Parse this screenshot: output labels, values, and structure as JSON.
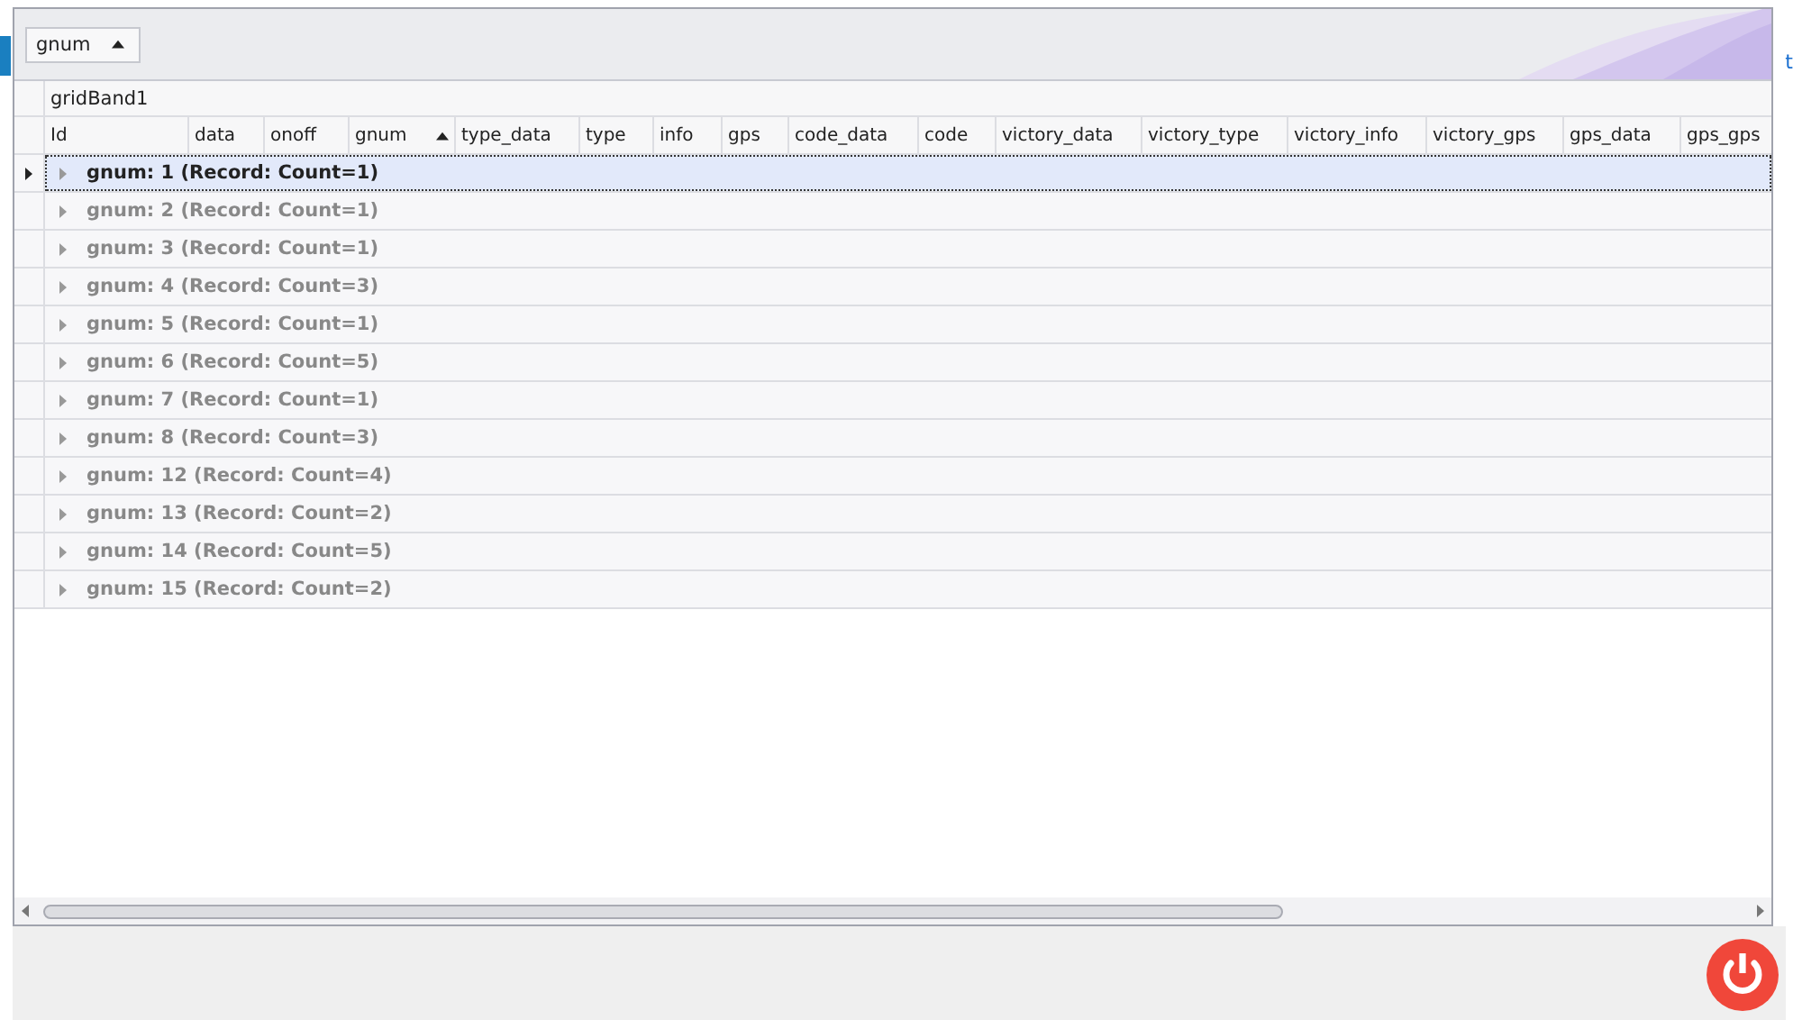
{
  "group_panel": {
    "sort_button": {
      "label": "gnum",
      "sorted": true
    }
  },
  "grid": {
    "band": "gridBand1",
    "columns": [
      {
        "label": "Id",
        "sorted": false
      },
      {
        "label": "data",
        "sorted": false
      },
      {
        "label": "onoff",
        "sorted": false
      },
      {
        "label": "gnum",
        "sorted": true
      },
      {
        "label": "type_data",
        "sorted": false
      },
      {
        "label": "type",
        "sorted": false
      },
      {
        "label": "info",
        "sorted": false
      },
      {
        "label": "gps",
        "sorted": false
      },
      {
        "label": "code_data",
        "sorted": false
      },
      {
        "label": "code",
        "sorted": false
      },
      {
        "label": "victory_data",
        "sorted": false
      },
      {
        "label": "victory_type",
        "sorted": false
      },
      {
        "label": "victory_info",
        "sorted": false
      },
      {
        "label": "victory_gps",
        "sorted": false
      },
      {
        "label": "gps_data",
        "sorted": false
      },
      {
        "label": "gps_gps",
        "sorted": false
      }
    ],
    "group_rows": [
      {
        "text": "gnum: 1 (Record: Count=1)",
        "selected": true
      },
      {
        "text": "gnum: 2 (Record: Count=1)",
        "selected": false
      },
      {
        "text": "gnum: 3 (Record: Count=1)",
        "selected": false
      },
      {
        "text": "gnum: 4 (Record: Count=3)",
        "selected": false
      },
      {
        "text": "gnum: 5 (Record: Count=1)",
        "selected": false
      },
      {
        "text": "gnum: 6 (Record: Count=5)",
        "selected": false
      },
      {
        "text": "gnum: 7 (Record: Count=1)",
        "selected": false
      },
      {
        "text": "gnum: 8 (Record: Count=3)",
        "selected": false
      },
      {
        "text": "gnum: 12 (Record: Count=4)",
        "selected": false
      },
      {
        "text": "gnum: 13 (Record: Count=2)",
        "selected": false
      },
      {
        "text": "gnum: 14 (Record: Count=5)",
        "selected": false
      },
      {
        "text": "gnum: 15 (Record: Count=2)",
        "selected": false
      }
    ]
  },
  "side_link": "t"
}
